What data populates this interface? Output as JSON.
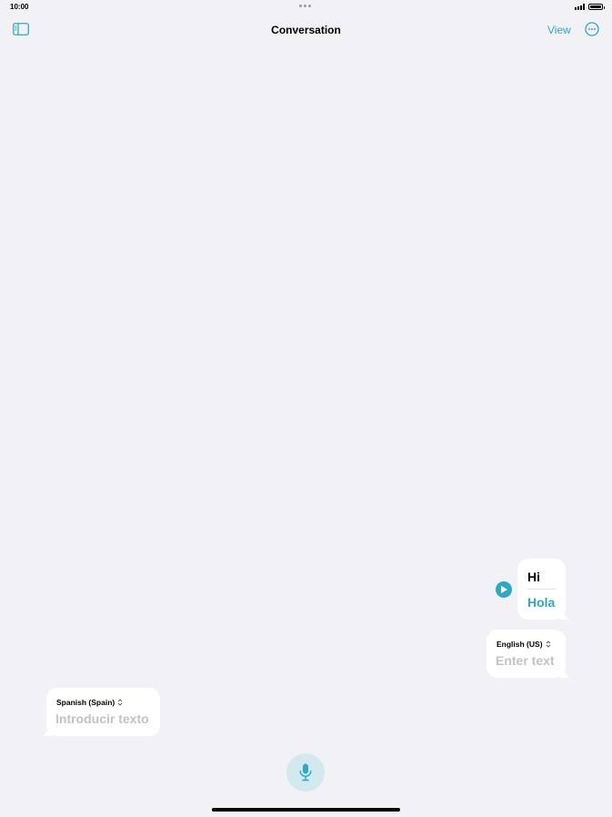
{
  "status_bar": {
    "time": "10:00"
  },
  "nav": {
    "title": "Conversation",
    "view_label": "View"
  },
  "conversation": {
    "messages": [
      {
        "source_text": "Hi",
        "translated_text": "Hola"
      }
    ]
  },
  "inputs": {
    "english": {
      "language": "English (US)",
      "placeholder": "Enter text"
    },
    "spanish": {
      "language": "Spanish (Spain)",
      "placeholder": "Introducir texto"
    }
  },
  "colors": {
    "accent": "#2fa8c4",
    "background": "#f1f1f6",
    "mic_background": "#d2e9f0"
  },
  "icons": {
    "sidebar": "sidebar-icon",
    "more": "ellipsis-circle-icon",
    "play": "play-icon",
    "mic": "microphone-icon",
    "chevron": "chevron-up-down-icon"
  }
}
